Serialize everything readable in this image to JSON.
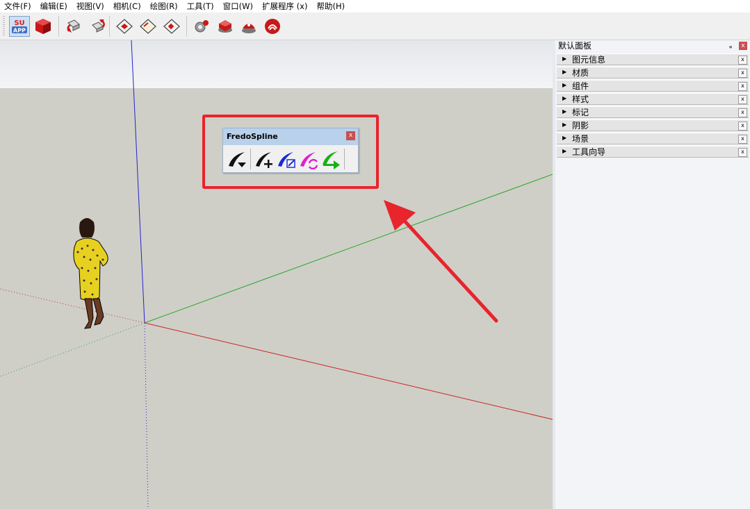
{
  "menu": [
    "文件(F)",
    "编辑(E)",
    "视图(V)",
    "相机(C)",
    "绘图(R)",
    "工具(T)",
    "窗口(W)",
    "扩展程序 (x)",
    "帮助(H)"
  ],
  "toolbar": {
    "su_app_label_top": "SU",
    "su_app_label_bottom": "APP",
    "icons": [
      "su-app-icon",
      "box-icon",
      "rotate-left-icon",
      "rotate-right-icon",
      "section-plane-icon",
      "section-plane-2-icon",
      "section-plane-3-icon",
      "gear-icon",
      "component-icon",
      "material-icon",
      "warehouse-icon"
    ]
  },
  "fredo": {
    "title": "FredoSpline",
    "close": "x",
    "icons": [
      "spline-dropdown-icon",
      "spline-add-icon",
      "spline-edit-icon",
      "spline-convert-icon",
      "spline-export-icon"
    ]
  },
  "panel": {
    "title": "默认面板",
    "pin": "ᵩ",
    "close": "x",
    "trays": [
      "图元信息",
      "材质",
      "组件",
      "样式",
      "标记",
      "阴影",
      "场景",
      "工具向导"
    ],
    "tray_close": "x"
  },
  "colors": {
    "highlight": "#e8242c",
    "axis_red": "#cc2222",
    "axis_green": "#2aa52a",
    "axis_blue": "#2222cc",
    "ground": "#cfcfc8",
    "sky_top": "#e6e8ec"
  }
}
